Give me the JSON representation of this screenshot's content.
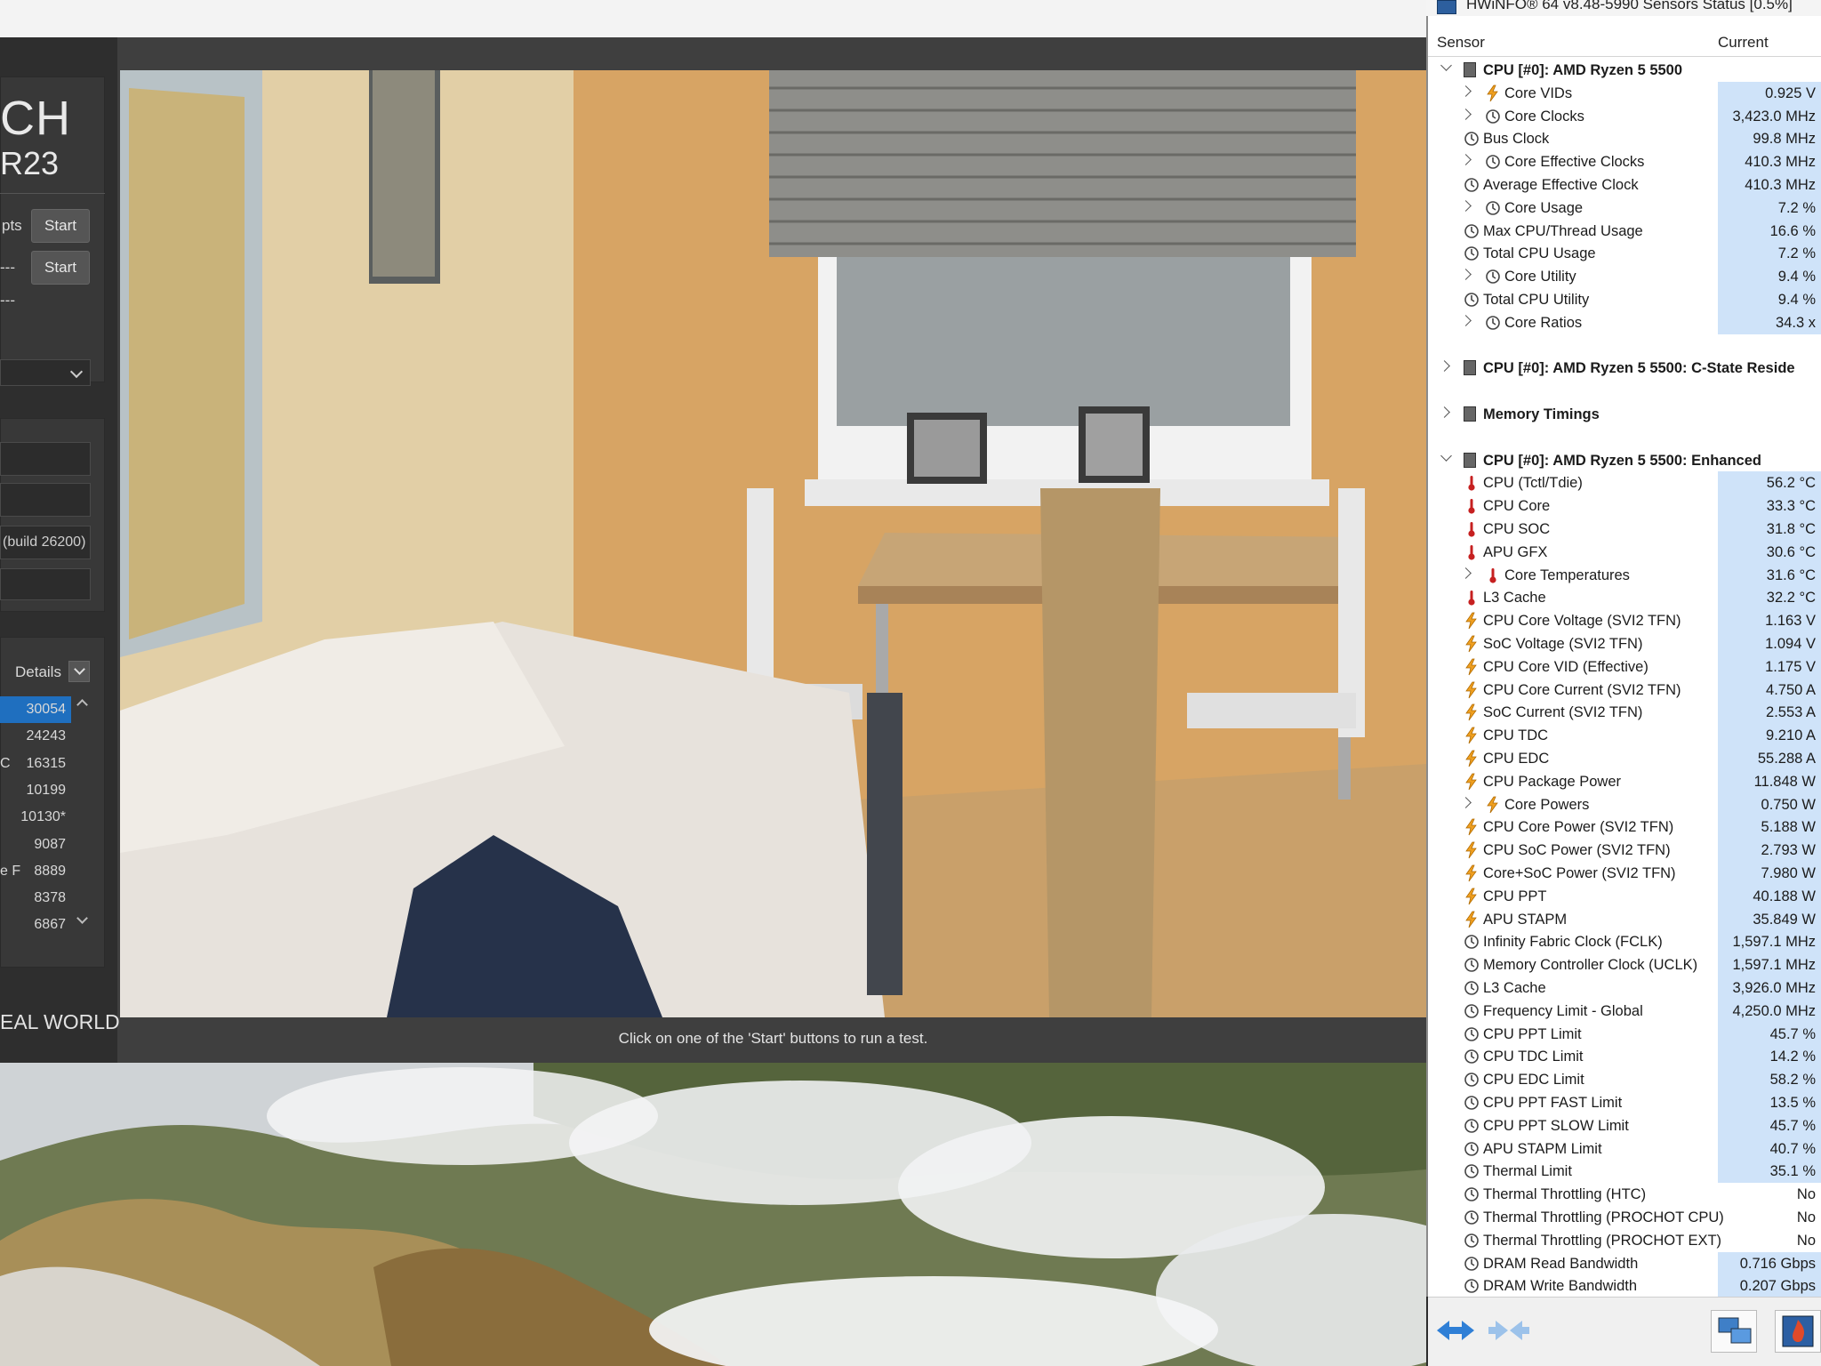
{
  "cinebench": {
    "logo_line1": "CH",
    "logo_line2": "R23",
    "multi_label": "pts",
    "start_label": "Start",
    "single_label": "---",
    "dash_row": "---",
    "field_build": "(build 26200)",
    "details_label": "Details",
    "ranking": [
      {
        "label": "",
        "value": "30054",
        "highlight": true
      },
      {
        "label": "",
        "value": "24243"
      },
      {
        "label": "C",
        "value": "16315"
      },
      {
        "label": "",
        "value": "10199"
      },
      {
        "label": "",
        "value": "10130*"
      },
      {
        "label": "",
        "value": "9087"
      },
      {
        "label": "e F",
        "value": "8889"
      },
      {
        "label": "",
        "value": "8378"
      },
      {
        "label": "",
        "value": "6867"
      }
    ],
    "realworld_text": "EAL WORLD",
    "status_message": "Click on one of the 'Start' buttons to run a test."
  },
  "hwinfo": {
    "title": "HWiNFO® 64 v8.48-5990 Sensors Status [0.5%]",
    "col_sensor": "Sensor",
    "col_current": "Current",
    "rows": [
      {
        "type": "group",
        "expanded": true,
        "label": "CPU [#0]: AMD Ryzen 5 5500"
      },
      {
        "type": "item",
        "indent": 2,
        "expand": true,
        "icon": "bolt",
        "label": "Core VIDs",
        "value": "0.925 V"
      },
      {
        "type": "item",
        "indent": 2,
        "expand": true,
        "icon": "clock",
        "label": "Core Clocks",
        "value": "3,423.0 MHz"
      },
      {
        "type": "item",
        "indent": 1,
        "icon": "clock",
        "label": "Bus Clock",
        "value": "99.8 MHz"
      },
      {
        "type": "item",
        "indent": 2,
        "expand": true,
        "icon": "clock",
        "label": "Core Effective Clocks",
        "value": "410.3 MHz"
      },
      {
        "type": "item",
        "indent": 1,
        "icon": "clock",
        "label": "Average Effective Clock",
        "value": "410.3 MHz"
      },
      {
        "type": "item",
        "indent": 2,
        "expand": true,
        "icon": "clock",
        "label": "Core Usage",
        "value": "7.2 %"
      },
      {
        "type": "item",
        "indent": 1,
        "icon": "clock",
        "label": "Max CPU/Thread Usage",
        "value": "16.6 %"
      },
      {
        "type": "item",
        "indent": 1,
        "icon": "clock",
        "label": "Total CPU Usage",
        "value": "7.2 %"
      },
      {
        "type": "item",
        "indent": 2,
        "expand": true,
        "icon": "clock",
        "label": "Core Utility",
        "value": "9.4 %"
      },
      {
        "type": "item",
        "indent": 1,
        "icon": "clock",
        "label": "Total CPU Utility",
        "value": "9.4 %"
      },
      {
        "type": "item",
        "indent": 2,
        "expand": true,
        "icon": "clock",
        "label": "Core Ratios",
        "value": "34.3 x"
      },
      {
        "type": "spacer"
      },
      {
        "type": "group",
        "expanded": false,
        "label": "CPU [#0]: AMD Ryzen 5 5500: C-State Reside"
      },
      {
        "type": "spacer"
      },
      {
        "type": "group",
        "expanded": false,
        "label": "Memory Timings"
      },
      {
        "type": "spacer"
      },
      {
        "type": "group",
        "expanded": true,
        "label": "CPU [#0]: AMD Ryzen 5 5500: Enhanced"
      },
      {
        "type": "item",
        "indent": 1,
        "icon": "temp",
        "label": "CPU (Tctl/Tdie)",
        "value": "56.2 °C"
      },
      {
        "type": "item",
        "indent": 1,
        "icon": "temp",
        "label": "CPU Core",
        "value": "33.3 °C"
      },
      {
        "type": "item",
        "indent": 1,
        "icon": "temp",
        "label": "CPU SOC",
        "value": "31.8 °C"
      },
      {
        "type": "item",
        "indent": 1,
        "icon": "temp",
        "label": "APU GFX",
        "value": "30.6 °C"
      },
      {
        "type": "item",
        "indent": 2,
        "expand": true,
        "icon": "temp",
        "label": "Core Temperatures",
        "value": "31.6 °C"
      },
      {
        "type": "item",
        "indent": 1,
        "icon": "temp",
        "label": "L3 Cache",
        "value": "32.2 °C"
      },
      {
        "type": "item",
        "indent": 1,
        "icon": "bolt",
        "label": "CPU Core Voltage (SVI2 TFN)",
        "value": "1.163 V"
      },
      {
        "type": "item",
        "indent": 1,
        "icon": "bolt",
        "label": "SoC Voltage (SVI2 TFN)",
        "value": "1.094 V"
      },
      {
        "type": "item",
        "indent": 1,
        "icon": "bolt",
        "label": "CPU Core VID (Effective)",
        "value": "1.175 V"
      },
      {
        "type": "item",
        "indent": 1,
        "icon": "bolt",
        "label": "CPU Core Current (SVI2 TFN)",
        "value": "4.750 A"
      },
      {
        "type": "item",
        "indent": 1,
        "icon": "bolt",
        "label": "SoC Current (SVI2 TFN)",
        "value": "2.553 A"
      },
      {
        "type": "item",
        "indent": 1,
        "icon": "bolt",
        "label": "CPU TDC",
        "value": "9.210 A"
      },
      {
        "type": "item",
        "indent": 1,
        "icon": "bolt",
        "label": "CPU EDC",
        "value": "55.288 A"
      },
      {
        "type": "item",
        "indent": 1,
        "icon": "bolt",
        "label": "CPU Package Power",
        "value": "11.848 W"
      },
      {
        "type": "item",
        "indent": 2,
        "expand": true,
        "icon": "bolt",
        "label": "Core Powers",
        "value": "0.750 W"
      },
      {
        "type": "item",
        "indent": 1,
        "icon": "bolt",
        "label": "CPU Core Power (SVI2 TFN)",
        "value": "5.188 W"
      },
      {
        "type": "item",
        "indent": 1,
        "icon": "bolt",
        "label": "CPU SoC Power (SVI2 TFN)",
        "value": "2.793 W"
      },
      {
        "type": "item",
        "indent": 1,
        "icon": "bolt",
        "label": "Core+SoC Power (SVI2 TFN)",
        "value": "7.980 W"
      },
      {
        "type": "item",
        "indent": 1,
        "icon": "bolt",
        "label": "CPU PPT",
        "value": "40.188 W"
      },
      {
        "type": "item",
        "indent": 1,
        "icon": "bolt",
        "label": "APU STAPM",
        "value": "35.849 W"
      },
      {
        "type": "item",
        "indent": 1,
        "icon": "clock",
        "label": "Infinity Fabric Clock (FCLK)",
        "value": "1,597.1 MHz"
      },
      {
        "type": "item",
        "indent": 1,
        "icon": "clock",
        "label": "Memory Controller Clock (UCLK)",
        "value": "1,597.1 MHz"
      },
      {
        "type": "item",
        "indent": 1,
        "icon": "clock",
        "label": "L3 Cache",
        "value": "3,926.0 MHz"
      },
      {
        "type": "item",
        "indent": 1,
        "icon": "clock",
        "label": "Frequency Limit - Global",
        "value": "4,250.0 MHz"
      },
      {
        "type": "item",
        "indent": 1,
        "icon": "clock",
        "label": "CPU PPT Limit",
        "value": "45.7 %"
      },
      {
        "type": "item",
        "indent": 1,
        "icon": "clock",
        "label": "CPU TDC Limit",
        "value": "14.2 %"
      },
      {
        "type": "item",
        "indent": 1,
        "icon": "clock",
        "label": "CPU EDC Limit",
        "value": "58.2 %"
      },
      {
        "type": "item",
        "indent": 1,
        "icon": "clock",
        "label": "CPU PPT FAST Limit",
        "value": "13.5 %"
      },
      {
        "type": "item",
        "indent": 1,
        "icon": "clock",
        "label": "CPU PPT SLOW Limit",
        "value": "45.7 %"
      },
      {
        "type": "item",
        "indent": 1,
        "icon": "clock",
        "label": "APU STAPM Limit",
        "value": "40.7 %"
      },
      {
        "type": "item",
        "indent": 1,
        "icon": "clock",
        "label": "Thermal Limit",
        "value": "35.1 %"
      },
      {
        "type": "item",
        "indent": 1,
        "icon": "clock",
        "label": "Thermal Throttling (HTC)",
        "value": "No",
        "plain": true
      },
      {
        "type": "item",
        "indent": 1,
        "icon": "clock",
        "label": "Thermal Throttling (PROCHOT CPU)",
        "value": "No",
        "plain": true
      },
      {
        "type": "item",
        "indent": 1,
        "icon": "clock",
        "label": "Thermal Throttling (PROCHOT EXT)",
        "value": "No",
        "plain": true
      },
      {
        "type": "item",
        "indent": 1,
        "icon": "clock",
        "label": "DRAM Read Bandwidth",
        "value": "0.716 Gbps"
      },
      {
        "type": "item",
        "indent": 1,
        "icon": "clock",
        "label": "DRAM Write Bandwidth",
        "value": "0.207 Gbps"
      }
    ],
    "toolbar": [
      "nav-expand-icon",
      "nav-collapse-icon",
      "network-icon",
      "sensor-settings-icon"
    ]
  }
}
